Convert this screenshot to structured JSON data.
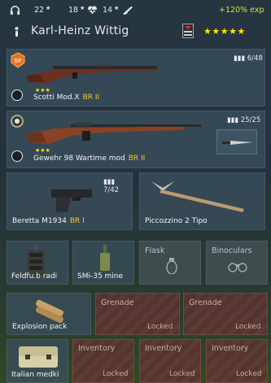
{
  "header": {
    "stats": [
      {
        "icon": "headphones-icon",
        "value": "22"
      },
      {
        "icon": "heart-pulse-icon",
        "value": "18"
      },
      {
        "icon": "rifle-icon",
        "value": "14"
      }
    ],
    "stat_star": "★",
    "exp_bonus": "+120% exp",
    "soldier_name": "Karl-Heinz Wittig",
    "rank_stars": "★★★★★"
  },
  "weapons": {
    "primary": {
      "name": "Scotti Mod.X",
      "br": "BR II",
      "ammo": "6/48",
      "level_stars": "★★★"
    },
    "secondary": {
      "name": "Gewehr 98 Wartime mod",
      "br": "BR II",
      "ammo": "25/25",
      "level_stars": "★★★"
    },
    "sidearm": {
      "name": "Beretta M1934",
      "br": "BR I",
      "ammo": "7/42"
    },
    "melee": {
      "name": "Piccozzino 2 Tipo"
    }
  },
  "equipment": {
    "radio": {
      "label": "Feldfu.b radi"
    },
    "mine": {
      "label": "SMi-35 mine"
    },
    "flask": {
      "title": "Flask"
    },
    "binoculars": {
      "title": "Binoculars"
    }
  },
  "row4": {
    "explosion": {
      "label": "Explosion pack"
    },
    "grenade1": {
      "title": "Grenade",
      "locked": "Locked"
    },
    "grenade2": {
      "title": "Grenade",
      "locked": "Locked"
    }
  },
  "row5": {
    "medkit": {
      "label": "Italian medki"
    },
    "inv1": {
      "title": "Inventory",
      "locked": "Locked"
    },
    "inv2": {
      "title": "Inventory",
      "locked": "Locked"
    },
    "inv3": {
      "title": "Inventory",
      "locked": "Locked"
    }
  },
  "colors": {
    "accent_yellow": "#ffe600",
    "br_orange": "#f3c53c",
    "exp_green": "#d7e04a",
    "locked_red": "#62343a"
  }
}
